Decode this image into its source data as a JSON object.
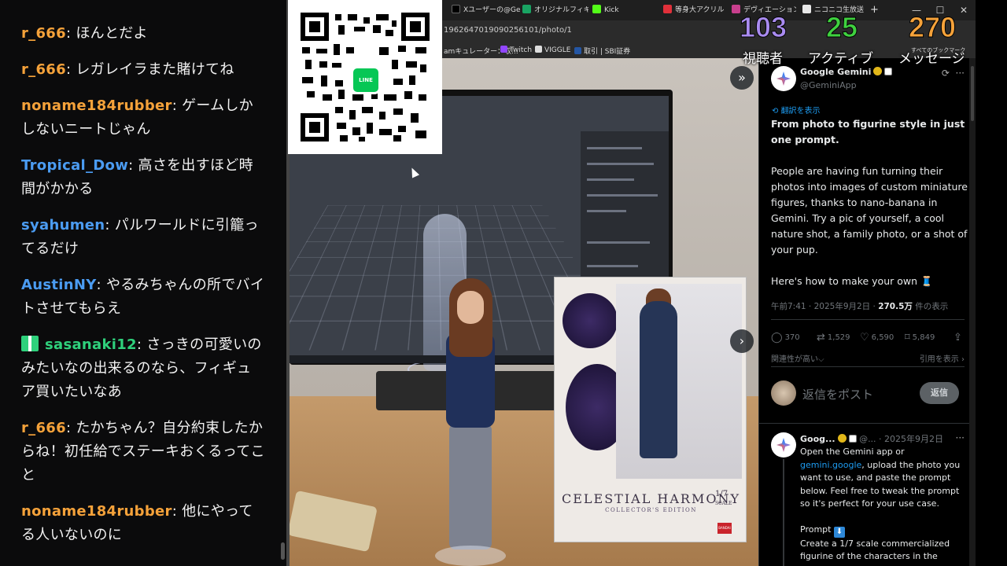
{
  "chat": {
    "messages": [
      {
        "user": "r_666",
        "sep": ": ",
        "text": "ほんとだよ",
        "color": "#f5a23a"
      },
      {
        "user": "r_666",
        "sep": ": ",
        "text": "レガレイラまた賭けてね",
        "color": "#f5a23a"
      },
      {
        "user": "noname184rubber",
        "sep": ": ",
        "text": "ゲームしかしないニートじゃん",
        "color": "#f5a23a"
      },
      {
        "user": "Tropical_Dow",
        "sep": ": ",
        "text": "高さを出すほど時間がかかる",
        "color": "#4b9cf2"
      },
      {
        "user": "syahumen",
        "sep": ": ",
        "text": "パルワールドに引籠ってるだけ",
        "color": "#4b9cf2"
      },
      {
        "user": "AustinNY",
        "sep": ": ",
        "text": "やるみちゃんの所でバイトさせてもらえ",
        "color": "#4b9cf2"
      },
      {
        "user": "sasanaki12",
        "sep": ": ",
        "text": "さっきの可愛いのみたいなの出来るのなら、フィギュア買いたいなあ",
        "color": "#2fd17c"
      },
      {
        "user": "r_666",
        "sep": ": ",
        "text": "たかちゃん？自分約束したからね！初任給でステーキおくるってこと",
        "color": "#f5a23a"
      },
      {
        "user": "noname184rubber",
        "sep": ": ",
        "text": "他にやってる人いないのに",
        "color": "#f5a23a"
      }
    ]
  },
  "stats": {
    "viewers": {
      "value": "103",
      "label": "視聴者",
      "color": "#a98bf0"
    },
    "active": {
      "value": "25",
      "label": "アクティブ",
      "color": "#3fd13f"
    },
    "messages": {
      "value": "270",
      "label": "メッセージ",
      "color": "#f5a23a"
    }
  },
  "browser": {
    "tabs": [
      {
        "label": "Xユーザーの@Ge",
        "icon": "x-icon",
        "color": "#000000"
      },
      {
        "label": "オリジナルフィギ",
        "icon": "doc-icon",
        "color": "#19a463"
      },
      {
        "label": "Kick",
        "icon": "kick-icon",
        "color": "#53fc18"
      },
      {
        "label": "等身大アクリル",
        "icon": "shop-icon",
        "color": "#e0303a"
      },
      {
        "label": "デヴィエーション",
        "icon": "site-icon",
        "color": "#c83f8d"
      },
      {
        "label": "ニコニコ生放送",
        "icon": "niconico-icon",
        "color": "#e8e8e8"
      }
    ],
    "new_tab": "+",
    "url": "1962647019090256101/photo/1",
    "bookmarks": [
      {
        "label": "amキュレーター：収...",
        "color": "#888888"
      },
      {
        "label": "Twitch",
        "color": "#9146ff"
      },
      {
        "label": "VIGGLE",
        "color": "#dddddd"
      },
      {
        "label": "取引 | SBI証券",
        "color": "#2456a4"
      }
    ],
    "bookmark_folder": "すべてのブックマーク",
    "window_controls": [
      "—",
      "☐",
      "✕"
    ]
  },
  "photo": {
    "box_title": "CELESTIAL HARMONY",
    "box_edition": "COLLECTOR'S EDITION",
    "box_scale": "1/7",
    "box_scale_sub": "SCALE",
    "box_brand": "BANDAI",
    "nav_next_top": "»",
    "nav_next": "›"
  },
  "post": {
    "author": "Google Gemini",
    "handle": "@GeminiApp",
    "translate": "翻訳を表示",
    "title": "From photo to figurine style in just one prompt.",
    "paragraph": "People are having fun turning their photos into images of custom miniature figures, thanks to nano-banana in Gemini. Try a pic of yourself, a cool nature shot, a family photo, or a shot of your pup.",
    "cta": "Here's how to make your own 🧵",
    "meta_time": "午前7:41 · 2025年9月2日 · ",
    "meta_views": "270.5万",
    "meta_views_suffix": " 件の表示",
    "replies": "370",
    "reposts": "1,529",
    "likes": "6,590",
    "bookmarks": "5,849",
    "relevance": "関連性が高い⌵",
    "quotes": "引用を表示 ›",
    "reply_placeholder": "返信をポスト",
    "reply_button": "返信"
  },
  "reply": {
    "author": "Goog...",
    "handle_date": "@... · 2025年9月2日",
    "line1": "Open the Gemini app or ",
    "link": "gemini.google",
    "line2": ", upload the photo you want to use, and paste the prompt below. Feel free to tweak the prompt so it's perfect for your use case.",
    "prompt_label": "Prompt",
    "prompt_emoji": "⬇",
    "prompt_text": "Create a 1/7 scale commercialized figurine of the characters in the"
  }
}
